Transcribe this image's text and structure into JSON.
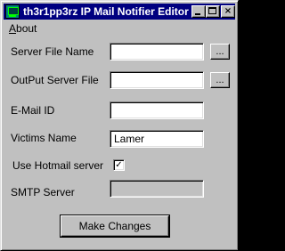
{
  "window": {
    "title": "th3r1pp3rz IP Mail Notifier Editor",
    "controls": {
      "minimize": "_",
      "maximize": "□",
      "close": "×"
    }
  },
  "menu": {
    "items": [
      {
        "label_underlined": "A",
        "label_rest": "bout"
      }
    ]
  },
  "form": {
    "server_file_name": {
      "label": "Server File Name",
      "value": "",
      "browse": "..."
    },
    "output_server_file": {
      "label": "OutPut Server File",
      "value": "",
      "browse": "..."
    },
    "email_id": {
      "label": "E-Mail ID",
      "value": ""
    },
    "victims_name": {
      "label": "Victims Name",
      "value": "Lamer"
    },
    "use_hotmail": {
      "label": "Use Hotmail server",
      "checked": true,
      "mark": "✓"
    },
    "smtp_server": {
      "label": "SMTP Server",
      "value": "",
      "enabled": false
    }
  },
  "actions": {
    "make_changes": "Make Changes"
  },
  "icons": {
    "app": "app-terminal-icon",
    "checkbox": "checkmark-icon"
  }
}
